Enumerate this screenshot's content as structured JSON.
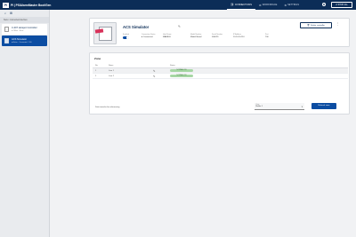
{
  "brand": {
    "logo": "PI",
    "name": "PI | PSIAlarmMaster Boot/Gen"
  },
  "nav": {
    "items": [
      {
        "icon": "⛓",
        "label": "CONNECTIONS"
      },
      {
        "icon": "⚙",
        "label": "WORKSPACE"
      },
      {
        "icon": "⚙",
        "label": "SETTINGS"
      }
    ],
    "help": "?",
    "stop_label": "⏻ STOP ALL"
  },
  "sidebar": {
    "section_title": "New / connected devices",
    "devices": [
      {
        "name": "C-007 Hotspot Controller",
        "sub": "● Offline · None"
      },
      {
        "name": "ACS Simulator",
        "sub": "● Active · Connected · 100"
      }
    ]
  },
  "device": {
    "title": "ACS Simulator",
    "enabled_label": "Enabled",
    "props": [
      {
        "label": "Connection Status",
        "value": "● Connected"
      },
      {
        "label": "Host Name",
        "value": "MAEBLE"
      },
      {
        "label": "Model Number",
        "value": "Model Board"
      },
      {
        "label": "Serial Number",
        "value": "000029"
      },
      {
        "label": "IP Address",
        "value": "10.10.10.110"
      },
      {
        "label": "Port",
        "value": "700"
      }
    ],
    "delete_label": "Delete controller"
  },
  "zones": {
    "title": "Zone",
    "columns": {
      "no": "No.",
      "name": "Name",
      "status": "Status"
    },
    "rows": [
      {
        "no": "1",
        "name": "Line 1",
        "status": "NORMAL/ON"
      },
      {
        "no": "2",
        "name": "Line 2",
        "status": "NORMAL/ON"
      }
    ],
    "footer_label": "Data transfer for referencing",
    "select_label": "Zone",
    "select_value": "Buffer 1",
    "refresh_label": "Refresh zone"
  },
  "colors": {
    "topbar": "#0c2d57",
    "accent": "#0c4da2",
    "status_ok": "#a6d6a4",
    "sim_tag": "#d8325a"
  }
}
